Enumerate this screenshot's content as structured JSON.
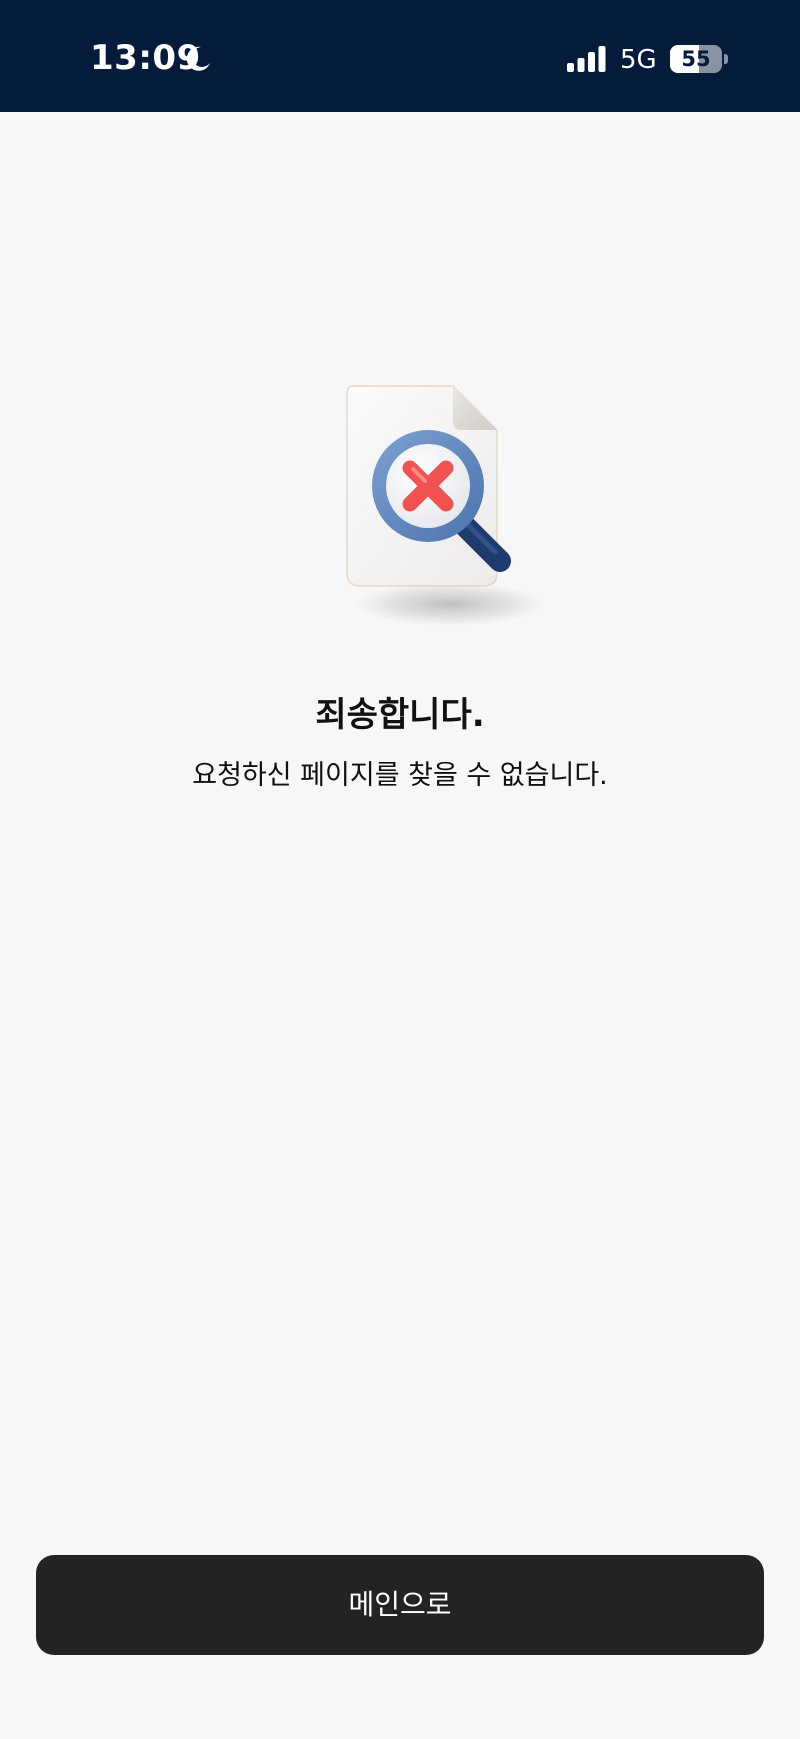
{
  "status_bar": {
    "time": "13:09",
    "network": "5G",
    "battery_level": "55",
    "battery_fraction": 0.55,
    "icons": [
      "moon-icon",
      "signal-icon",
      "battery-icon"
    ],
    "background_color": "#051b3c"
  },
  "illustration": {
    "icon": "document-search-error-icon"
  },
  "content": {
    "title": "죄송합니다.",
    "message": "요청하신 페이지를 찾을 수 없습니다."
  },
  "button": {
    "label": "메인으로",
    "color": "#232323"
  },
  "colors": {
    "page_background": "#f7f7f7",
    "error_red": "#f0524f",
    "magnifier_blue": "#5b86bf",
    "handle_navy": "#1f3b6e"
  }
}
